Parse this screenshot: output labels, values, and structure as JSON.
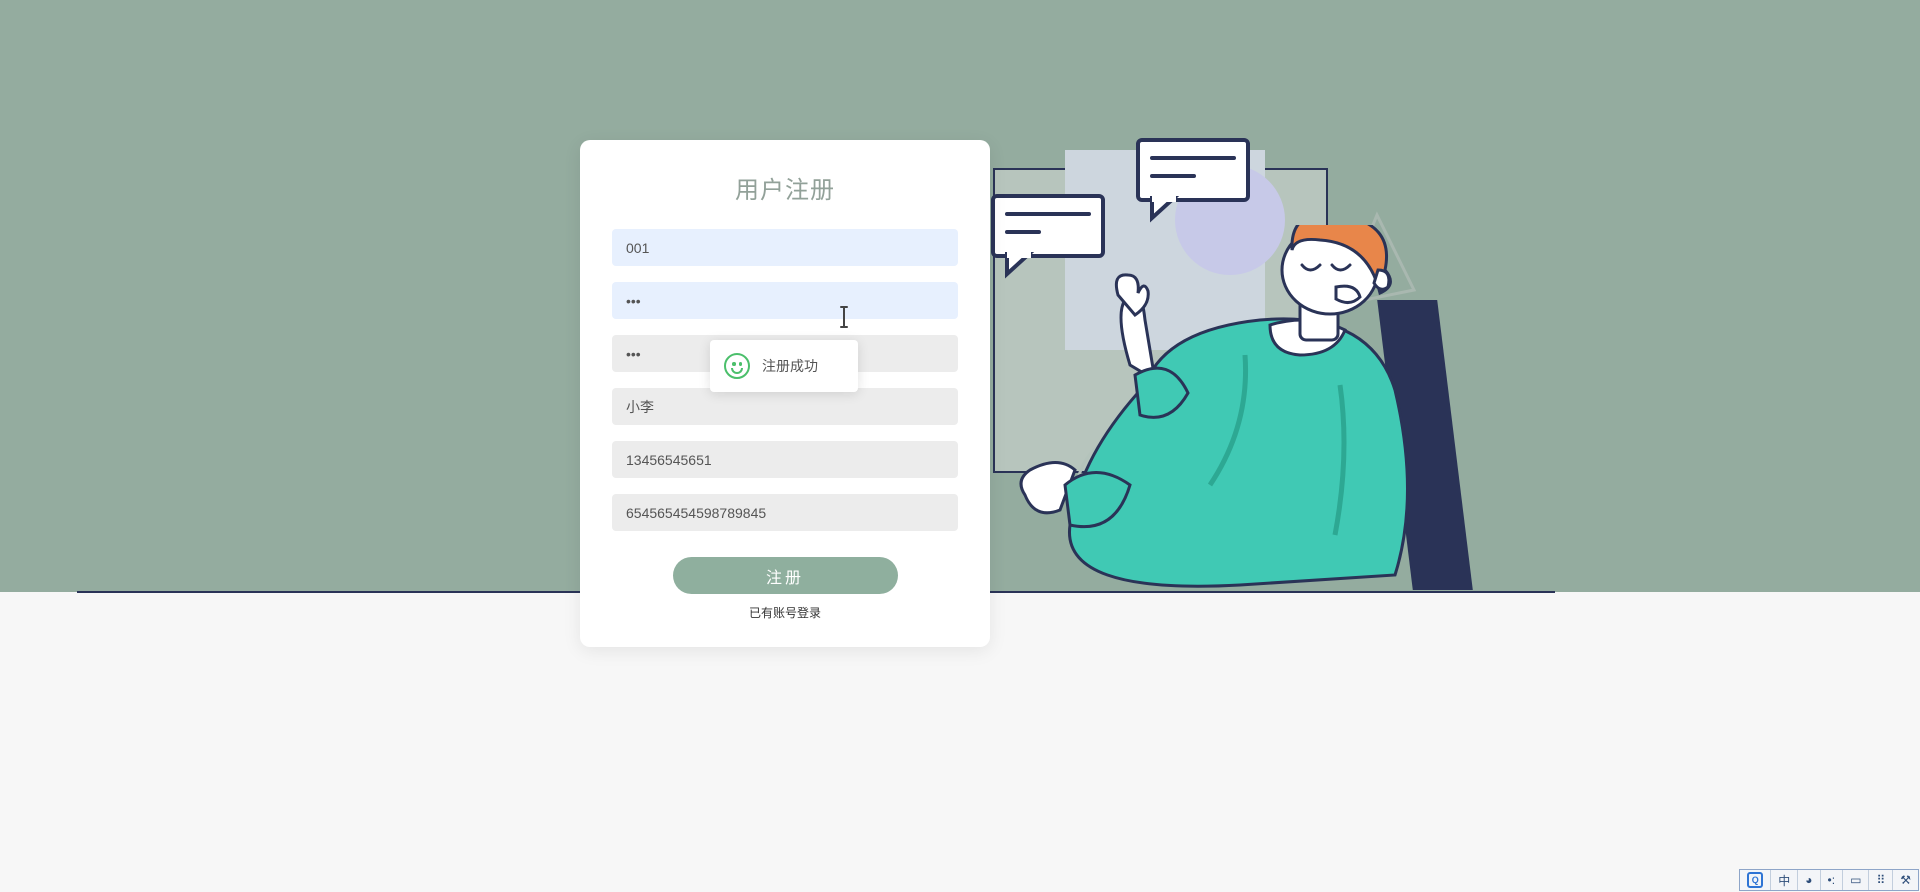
{
  "card": {
    "title": "用户注册",
    "fields": {
      "user_id": "001",
      "password": "•••",
      "confirm_password": "•••",
      "realname": "小李",
      "phone": "13456545651",
      "idcard": "654565454598789845"
    },
    "register_button": "注册",
    "login_link": "已有账号登录"
  },
  "toast": {
    "message": "注册成功"
  },
  "ime": {
    "logo_letter": "Q",
    "lang": "中",
    "punct_glyph": "◕",
    "punct_small": "•:",
    "kbd_glyph": "▭",
    "tool_glyph": "⚒"
  }
}
